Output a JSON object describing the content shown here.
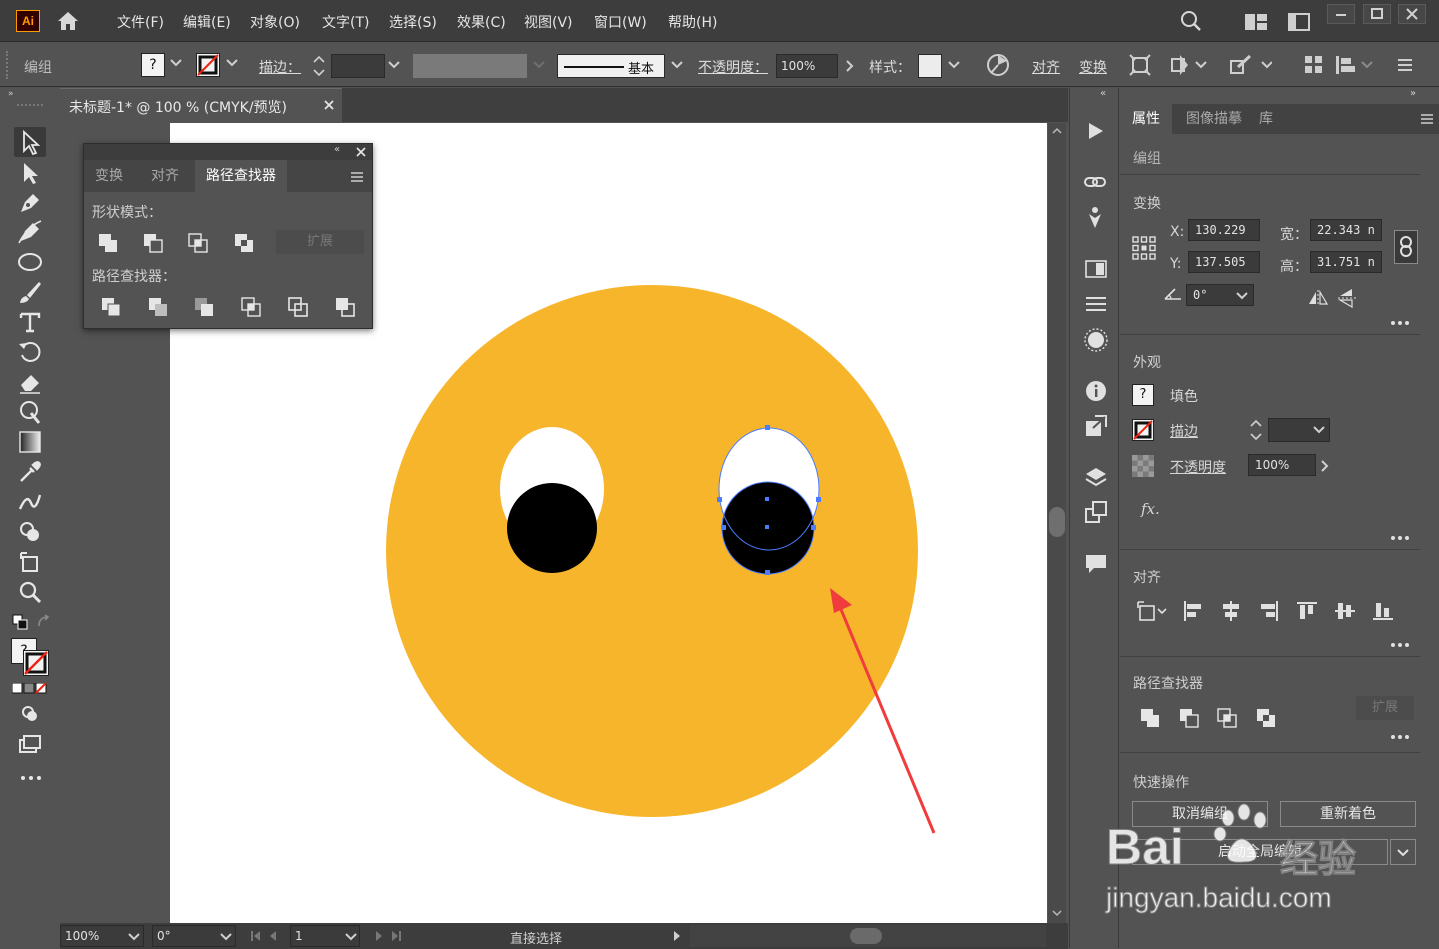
{
  "app": {
    "logo_text": "Ai",
    "accent": "#ff9a00"
  },
  "menu": [
    "文件(F)",
    "编辑(E)",
    "对象(O)",
    "文字(T)",
    "选择(S)",
    "效果(C)",
    "视图(V)",
    "窗口(W)",
    "帮助(H)"
  ],
  "control_bar": {
    "selection_label": "编组",
    "fill_value": "?",
    "stroke_label": "描边：",
    "stroke_profile": "基本",
    "opacity_label": "不透明度：",
    "opacity_value": "100%",
    "style_label": "样式：",
    "align_label": "对齐",
    "transform_label": "变换"
  },
  "document": {
    "tab_title": "未标题-1* @ 100 % (CMYK/预览)"
  },
  "pathfinder_panel": {
    "tabs": [
      "变换",
      "对齐",
      "路径查找器"
    ],
    "active_tab": "路径查找器",
    "shape_modes_label": "形状模式：",
    "expand_label": "扩展",
    "pathfinders_label": "路径查找器："
  },
  "artwork": {
    "face_color": "#f7b52c",
    "eye_white": "#ffffff",
    "pupil": "#000000",
    "selection_color": "#4a7cff",
    "arrow_color": "#f03c3c"
  },
  "status_bar": {
    "zoom": "100%",
    "rotation": "0°",
    "artboard": "1",
    "tool": "直接选择"
  },
  "properties_panel": {
    "tabs": [
      "属性",
      "图像描摹",
      "库"
    ],
    "active_tab": "属性",
    "selection": "编组",
    "transform_title": "变换",
    "x_label": "X:",
    "x_value": "130.229",
    "y_label": "Y:",
    "y_value": "137.505",
    "w_label": "宽：",
    "w_value": "22.343 n",
    "h_label": "高：",
    "h_value": "31.751 n",
    "angle_value": "0°",
    "appearance_title": "外观",
    "fill_label": "填色",
    "fill_value": "?",
    "stroke_label": "描边",
    "opacity_label": "不透明度",
    "opacity_value": "100%",
    "fx_label": "fx.",
    "align_title": "对齐",
    "pathfinder_title": "路径查找器",
    "expand_label": "扩展",
    "quick_actions_title": "快速操作",
    "ungroup_button": "取消编组",
    "recolor_button": "重新着色",
    "global_edit_button": "启动全局编辑"
  },
  "watermark": {
    "brand": "Bai",
    "paw": "经验",
    "url": "jingyan.baidu.com"
  }
}
